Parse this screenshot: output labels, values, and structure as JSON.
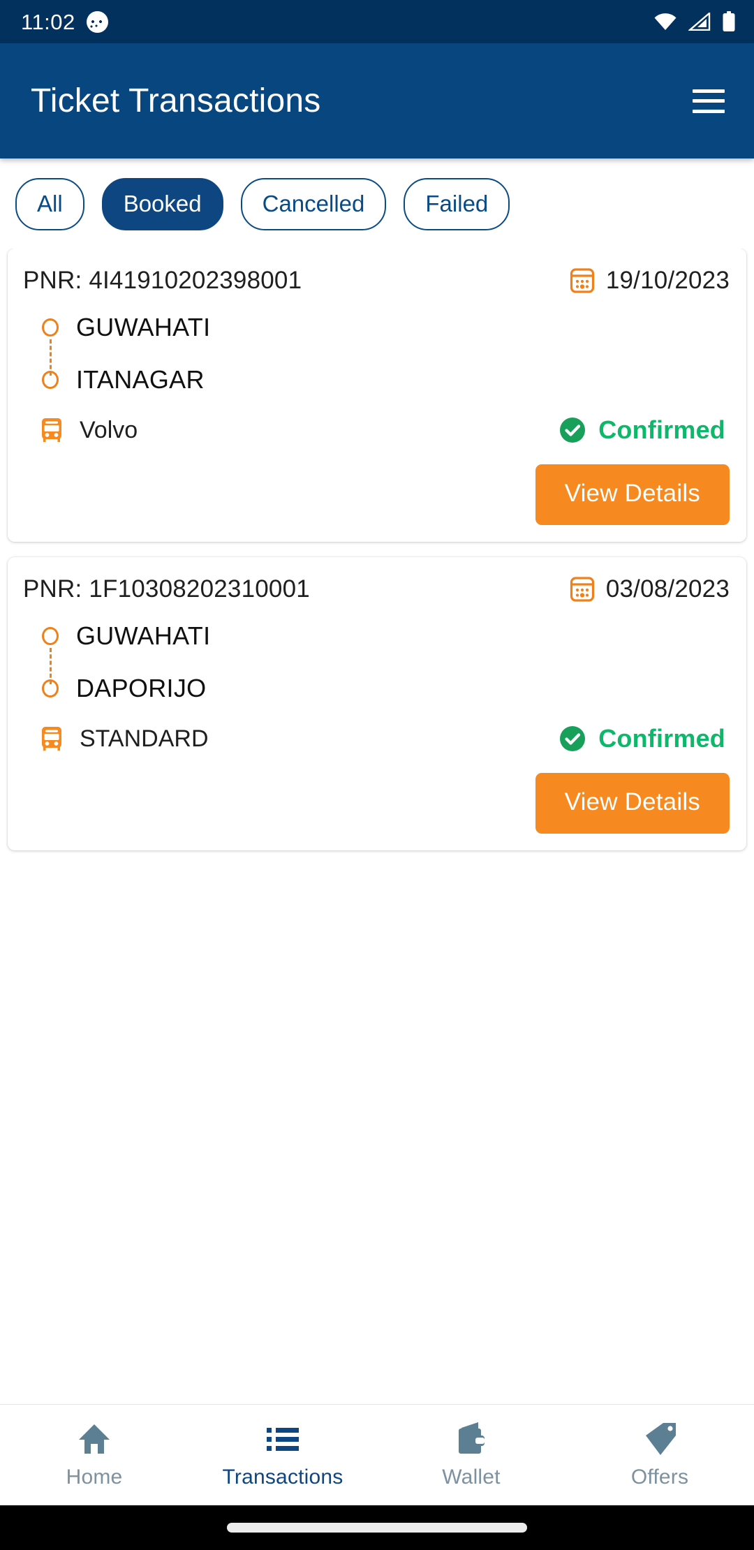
{
  "status_bar": {
    "time": "11:02",
    "app_icon": "koala-app-icon",
    "icons": [
      "wifi-icon",
      "cellular-signal-icon",
      "battery-icon"
    ],
    "background": "#03315e"
  },
  "app_bar": {
    "title": "Ticket Transactions",
    "menu_icon": "hamburger-menu-icon",
    "background": "#07467f",
    "text_color": "#ffffff"
  },
  "filters": {
    "selected": "Booked",
    "selected_background": "#0d4680",
    "outline_color": "#0a4b86",
    "chips": [
      {
        "label": "All",
        "selected": false
      },
      {
        "label": "Booked",
        "selected": true
      },
      {
        "label": "Cancelled",
        "selected": false
      },
      {
        "label": "Failed",
        "selected": false
      }
    ]
  },
  "colors": {
    "orange": "#f6891f",
    "orange_icon": "#f08019",
    "green": "#0cb96b",
    "navy": "#0d4680",
    "nav_inactive": "#7d919f"
  },
  "transactions": [
    {
      "pnr_label": "PNR: 4I41910202398001",
      "date": "19/10/2023",
      "calendar_icon": "calendar-icon",
      "origin": "GUWAHATI",
      "destination": "ITANAGAR",
      "bus_icon": "bus-icon",
      "service": "Volvo",
      "status_icon": "check-circle-icon",
      "status": "Confirmed",
      "action_label": "View Details"
    },
    {
      "pnr_label": "PNR: 1F10308202310001",
      "date": "03/08/2023",
      "calendar_icon": "calendar-icon",
      "origin": "GUWAHATI",
      "destination": "DAPORIJO",
      "bus_icon": "bus-icon",
      "service": "STANDARD",
      "status_icon": "check-circle-icon",
      "status": "Confirmed",
      "action_label": "View Details"
    }
  ],
  "bottom_nav": {
    "active": "Transactions",
    "items": [
      {
        "label": "Home",
        "icon": "home-icon",
        "active": false
      },
      {
        "label": "Transactions",
        "icon": "list-icon",
        "active": true
      },
      {
        "label": "Wallet",
        "icon": "wallet-icon",
        "active": false
      },
      {
        "label": "Offers",
        "icon": "tag-icon",
        "active": false
      }
    ]
  }
}
